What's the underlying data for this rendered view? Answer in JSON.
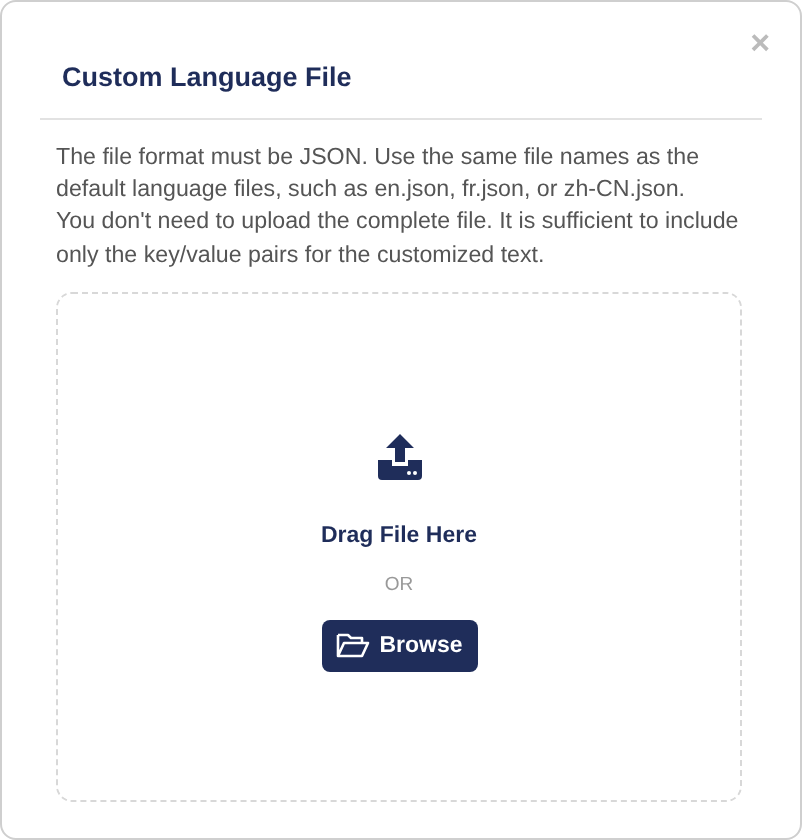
{
  "dialog": {
    "title": "Custom Language File",
    "close": "×"
  },
  "paragraphs": [
    "The file format must be JSON. Use the same file names as the default language files, such as en.json, fr.json, or zh-CN.json.",
    "You don't need to upload the complete file. It is sufficient to include only the key/value pairs for the customized text."
  ],
  "dropzone": {
    "label": "Drag File Here",
    "separator": "OR",
    "button": "Browse"
  }
}
